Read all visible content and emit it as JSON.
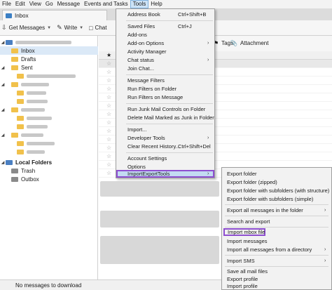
{
  "menubar": {
    "items": [
      "File",
      "Edit",
      "View",
      "Go",
      "Message",
      "Events and Tasks",
      "Tools",
      "Help"
    ]
  },
  "tab": {
    "label": "Inbox"
  },
  "toolbar": {
    "get_messages": "Get Messages",
    "write": "Write",
    "chat": "Chat",
    "tags": "Tags",
    "attachment": "Attachment"
  },
  "folders": {
    "inbox": "Inbox",
    "drafts": "Drafts",
    "sent": "Sent",
    "local_folders": "Local Folders",
    "trash": "Trash",
    "outbox": "Outbox"
  },
  "tools_menu": {
    "address_book": "Address Book",
    "address_book_sc": "Ctrl+Shift+B",
    "saved_files": "Saved Files",
    "saved_files_sc": "Ctrl+J",
    "add_ons": "Add-ons",
    "add_on_options": "Add-on Options",
    "activity_manager": "Activity Manager",
    "chat_status": "Chat status",
    "join_chat": "Join Chat...",
    "message_filters": "Message Filters",
    "run_filters_folder": "Run Filters on Folder",
    "run_filters_message": "Run Filters on Message",
    "run_junk": "Run Junk Mail Controls on Folder",
    "delete_junk": "Delete Mail Marked as Junk in Folder",
    "import": "Import...",
    "developer_tools": "Developer Tools",
    "clear_history": "Clear Recent History...",
    "clear_history_sc": "Ctrl+Shift+Del",
    "account_settings": "Account Settings",
    "options": "Options",
    "importexporttools": "ImportExportTools"
  },
  "submenu": {
    "export_folder": "Export folder",
    "export_folder_zipped": "Export folder (zipped)",
    "export_subfolders_structure": "Export folder with subfolders (with structure)",
    "export_subfolders_simple": "Export folder with subfolders (simple)",
    "export_all_messages": "Export all messages in the folder",
    "search_export": "Search and export",
    "import_mbox": "Import mbox file",
    "import_messages": "Import messages",
    "import_all_directory": "Import all messages from a directory",
    "import_sms": "Import SMS",
    "save_all_mail": "Save all mail files",
    "export_profile": "Export profile",
    "import_profile": "Import profile"
  },
  "status": {
    "text": "No messages to download"
  }
}
